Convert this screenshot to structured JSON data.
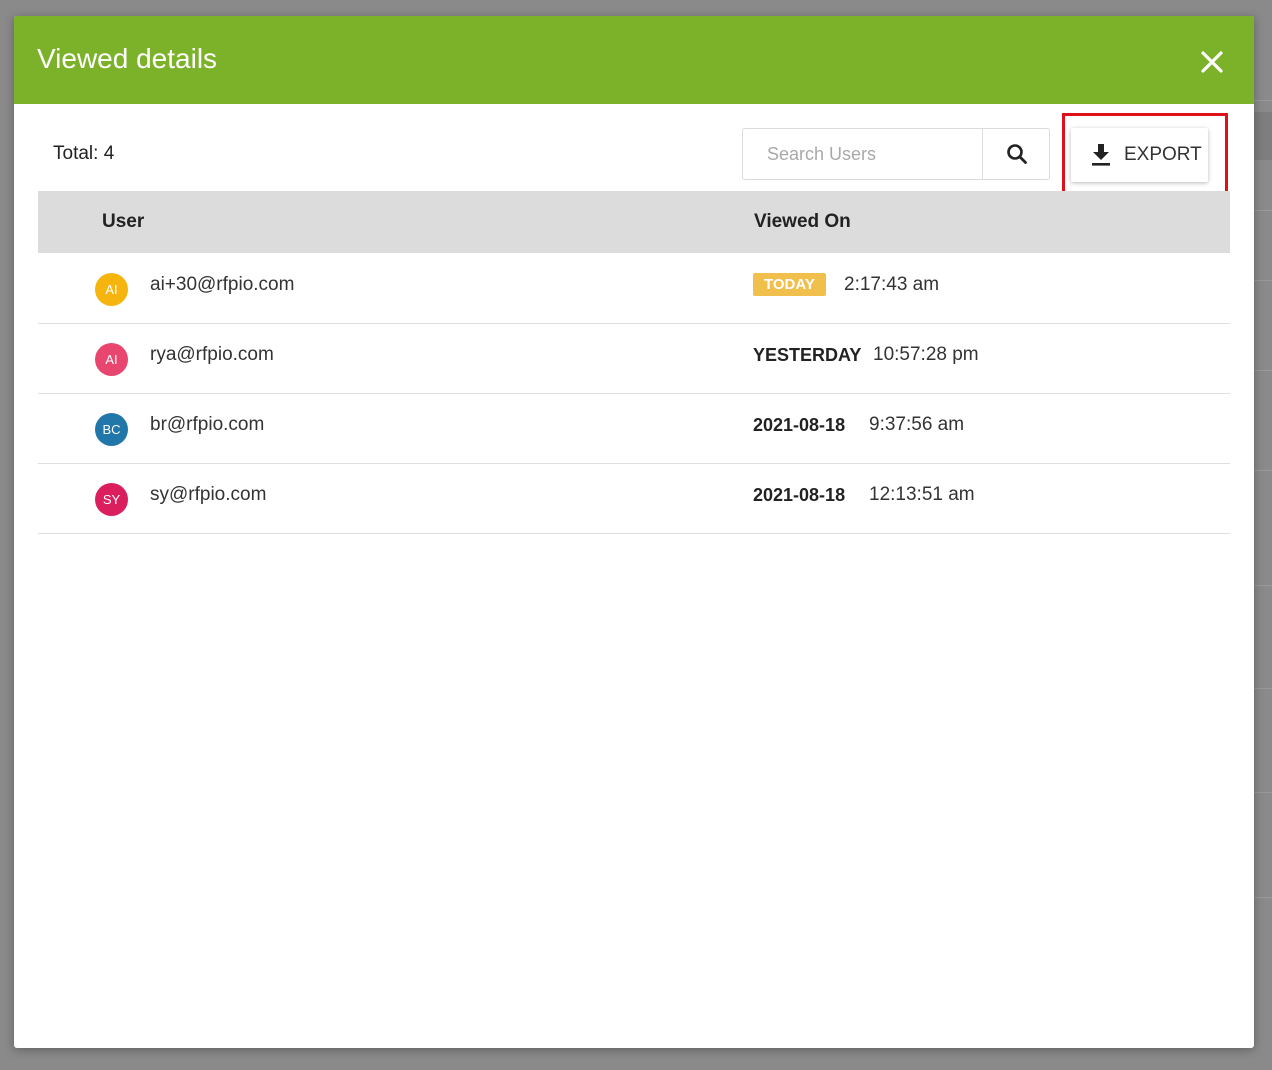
{
  "modal": {
    "title": "Viewed details",
    "header_color": "#7cb22a",
    "close_icon": "close-icon"
  },
  "toolbar": {
    "total_label": "Total: 4",
    "search_placeholder": "Search Users",
    "search_icon": "search-icon",
    "export_label": "EXPORT",
    "export_icon": "download-icon",
    "highlight_color": "#e0101a"
  },
  "table": {
    "columns": [
      "User",
      "Viewed On"
    ],
    "rows": [
      {
        "initials": "AI",
        "avatar_color": "#f6b40e",
        "email": "ai+30@rfpio.com",
        "day": "TODAY",
        "time": "2:17:43 am"
      },
      {
        "initials": "AI",
        "avatar_color": "#e8466e",
        "email": "rya@rfpio.com",
        "day": "YESTERDAY",
        "time": "10:57:28 pm"
      },
      {
        "initials": "BC",
        "avatar_color": "#2277aa",
        "email": "br@rfpio.com",
        "day": "2021-08-18",
        "time": "9:37:56 am"
      },
      {
        "initials": "SY",
        "avatar_color": "#db1f5e",
        "email": "sy@rfpio.com",
        "day": "2021-08-18",
        "time": "12:13:51 am"
      }
    ]
  }
}
